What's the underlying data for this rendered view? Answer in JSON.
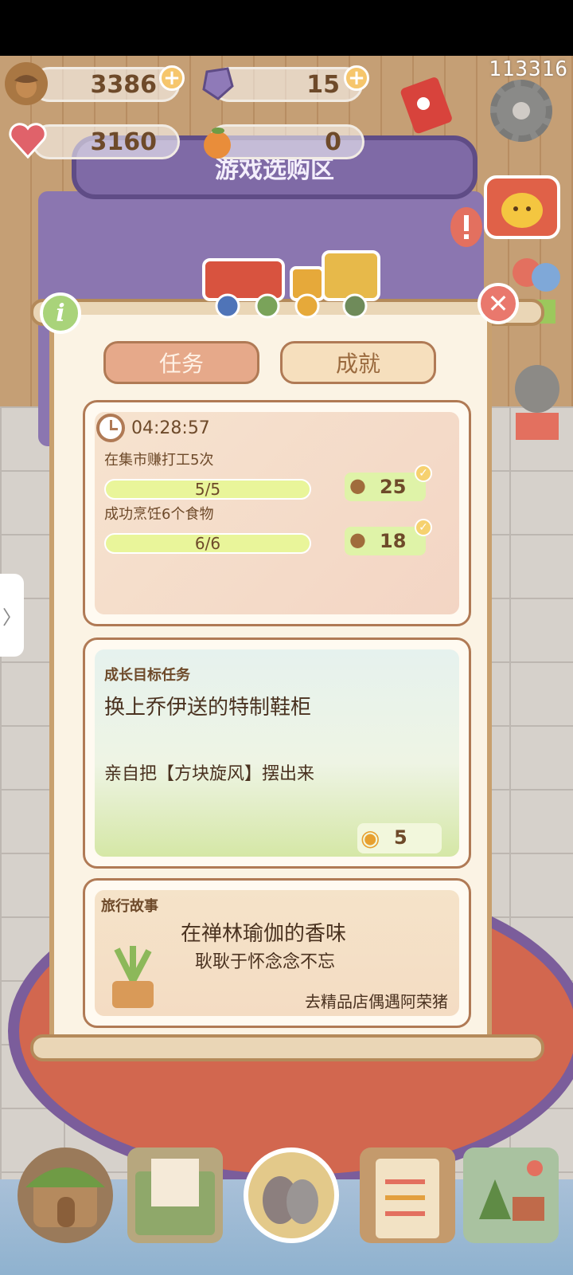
{
  "hud": {
    "user_id": "113316",
    "acorns": "3386",
    "gems": "15",
    "hearts": "3160",
    "oranges": "0",
    "plus_label": "+"
  },
  "shop": {
    "sign": "游戏选购区"
  },
  "panel": {
    "info_label": "i",
    "close_label": "✕",
    "tabs": [
      {
        "label": "任务",
        "active": true
      },
      {
        "label": "成就",
        "active": false
      }
    ],
    "daily": {
      "timer": "04:28:57",
      "tasks": [
        {
          "title": "在集市赚打工5次",
          "progress": "5/5",
          "progress_fraction": 1.0,
          "reward": "25",
          "reward_icon": "acorn-icon",
          "completed": true
        },
        {
          "title": "成功烹饪6个食物",
          "progress": "6/6",
          "progress_fraction": 1.0,
          "reward": "18",
          "reward_icon": "acorn-icon",
          "completed": true
        }
      ]
    },
    "growth": {
      "header": "成长目标任务",
      "title": "换上乔伊送的特制鞋柜",
      "description": "亲自把【方块旋风】摆出来",
      "reward": "5",
      "reward_icon": "bell-icon"
    },
    "story": {
      "header": "旅行故事",
      "title": "在禅林瑜伽的香味",
      "subtitle": "耿耿于怀念念不忘",
      "hint": "去精品店偶遇阿荣猪"
    }
  },
  "colors": {
    "panel_bg": "#fbf3e4",
    "border": "#b07a55",
    "text": "#6e4a2a",
    "tab_active": "#e6a98a",
    "progress": "#e9f59a",
    "reward_bg": "#dff3a8",
    "close": "#e9786d",
    "info": "#a9d37a"
  }
}
